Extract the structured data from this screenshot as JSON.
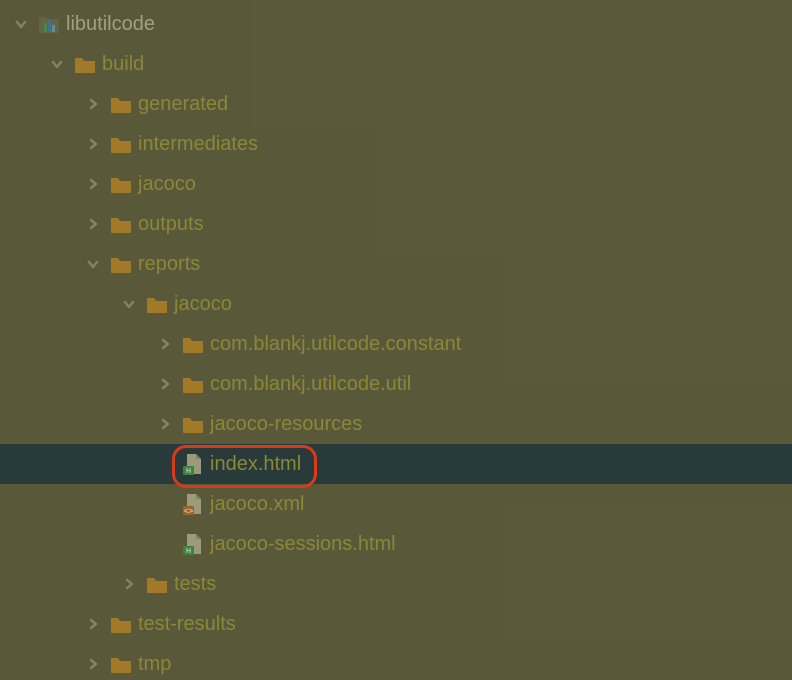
{
  "colors": {
    "folder": "#c98a2a",
    "chevron": "#9a9a80",
    "selection": "#0f2a44",
    "highlight": "#d83a1a",
    "label": "#a8a040",
    "root": "#c8c8b0"
  },
  "tree": [
    {
      "id": 0,
      "depth": 0,
      "toggle": "down",
      "icon": "module",
      "label": "libutilcode",
      "rootLabel": true
    },
    {
      "id": 1,
      "depth": 1,
      "toggle": "down",
      "icon": "folder",
      "label": "build"
    },
    {
      "id": 2,
      "depth": 2,
      "toggle": "right",
      "icon": "folder",
      "label": "generated"
    },
    {
      "id": 3,
      "depth": 2,
      "toggle": "right",
      "icon": "folder",
      "label": "intermediates"
    },
    {
      "id": 4,
      "depth": 2,
      "toggle": "right",
      "icon": "folder",
      "label": "jacoco"
    },
    {
      "id": 5,
      "depth": 2,
      "toggle": "right",
      "icon": "folder",
      "label": "outputs"
    },
    {
      "id": 6,
      "depth": 2,
      "toggle": "down",
      "icon": "folder",
      "label": "reports"
    },
    {
      "id": 7,
      "depth": 3,
      "toggle": "down",
      "icon": "folder",
      "label": "jacoco"
    },
    {
      "id": 8,
      "depth": 4,
      "toggle": "right",
      "icon": "folder",
      "label": "com.blankj.utilcode.constant"
    },
    {
      "id": 9,
      "depth": 4,
      "toggle": "right",
      "icon": "folder",
      "label": "com.blankj.utilcode.util"
    },
    {
      "id": 10,
      "depth": 4,
      "toggle": "right",
      "icon": "folder",
      "label": "jacoco-resources"
    },
    {
      "id": 11,
      "depth": 4,
      "toggle": "none",
      "icon": "html",
      "label": "index.html",
      "selected": true,
      "highlighted": true
    },
    {
      "id": 12,
      "depth": 4,
      "toggle": "none",
      "icon": "xml",
      "label": "jacoco.xml"
    },
    {
      "id": 13,
      "depth": 4,
      "toggle": "none",
      "icon": "html",
      "label": "jacoco-sessions.html"
    },
    {
      "id": 14,
      "depth": 3,
      "toggle": "right",
      "icon": "folder",
      "label": "tests"
    },
    {
      "id": 15,
      "depth": 2,
      "toggle": "right",
      "icon": "folder",
      "label": "test-results"
    },
    {
      "id": 16,
      "depth": 2,
      "toggle": "right",
      "icon": "folder",
      "label": "tmp"
    }
  ]
}
